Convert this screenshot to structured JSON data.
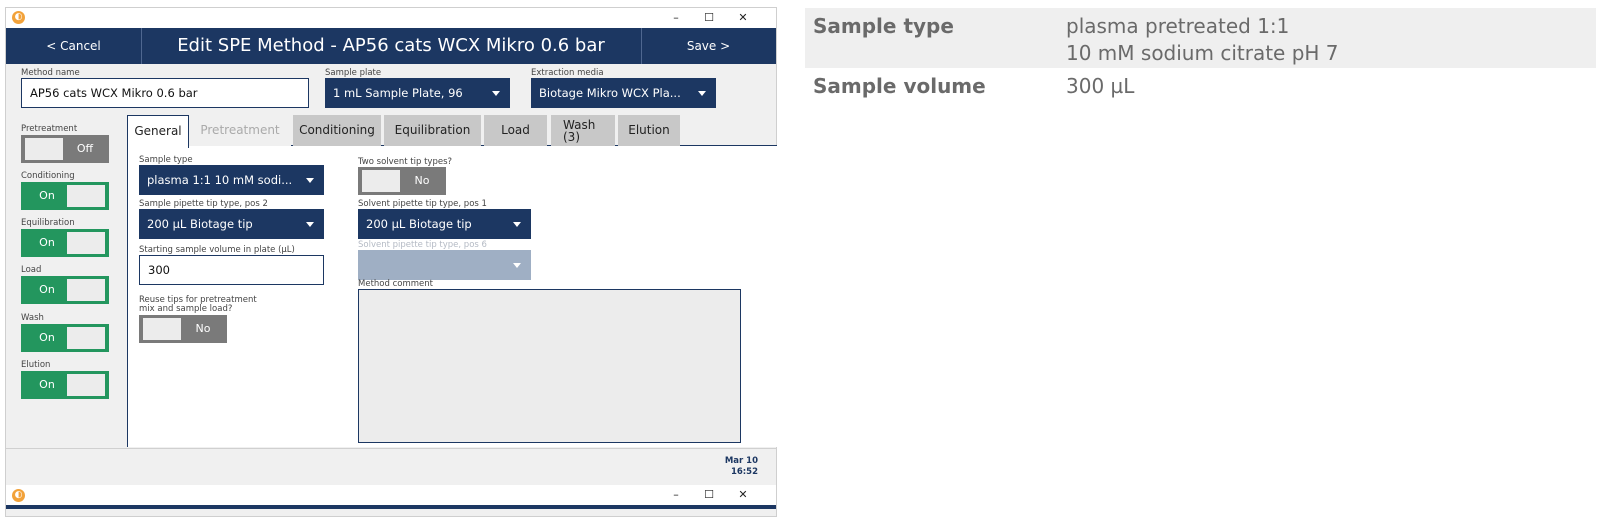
{
  "window": {
    "minimize": "–",
    "maximize": "☐",
    "close": "✕"
  },
  "header": {
    "cancel": "< Cancel",
    "title": "Edit SPE Method - AP56 cats WCX Mikro 0.6 bar",
    "save": "Save >"
  },
  "fields": {
    "method_name_label": "Method name",
    "method_name_value": "AP56 cats WCX Mikro 0.6 bar",
    "sample_plate_label": "Sample plate",
    "sample_plate_value": "1 mL Sample Plate, 96",
    "extraction_media_label": "Extraction media",
    "extraction_media_value": "Biotage Mikro WCX Pla..."
  },
  "sidebar": {
    "pretreatment": {
      "label": "Pretreatment",
      "state": "Off"
    },
    "conditioning": {
      "label": "Conditioning",
      "state": "On"
    },
    "equilibration": {
      "label": "Equilibration",
      "state": "On"
    },
    "load": {
      "label": "Load",
      "state": "On"
    },
    "wash": {
      "label": "Wash",
      "state": "On"
    },
    "elution": {
      "label": "Elution",
      "state": "On"
    }
  },
  "tabs": {
    "general": "General",
    "pretreatment": "Pretreatment",
    "conditioning": "Conditioning",
    "equilibration": "Equilibration",
    "load": "Load",
    "wash_line1": "Wash",
    "wash_line2": "(3)",
    "elution": "Elution"
  },
  "general": {
    "sample_type_label": "Sample type",
    "sample_type_value": "plasma 1:1 10 mM sodi...",
    "sample_tip_label": "Sample pipette tip type, pos 2",
    "sample_tip_value": "200 µL Biotage tip",
    "start_volume_label": "Starting sample volume in plate (µL)",
    "start_volume_value": "300",
    "reuse_label_1": "Reuse tips for pretreatment",
    "reuse_label_2": "mix and sample load?",
    "reuse_state": "No",
    "two_solvent_label": "Two solvent tip types?",
    "two_solvent_state": "No",
    "solvent_tip1_label": "Solvent pipette tip type, pos 1",
    "solvent_tip1_value": "200 µL Biotage tip",
    "solvent_tip6_label": "Solvent pipette tip type, pos 6",
    "method_comment_label": "Method comment"
  },
  "status": {
    "date": "Mar 10",
    "time": "16:52"
  },
  "info_table": {
    "rows": [
      {
        "key": "Sample type",
        "value_line1": "plasma pretreated 1:1",
        "value_line2": "10 mM sodium citrate pH 7"
      },
      {
        "key": "Sample volume",
        "value_line1": "300 µL",
        "value_line2": ""
      }
    ]
  },
  "colors": {
    "navy": "#1c3762",
    "toggle_on": "#23965e",
    "toggle_off": "#7a7a7a"
  }
}
